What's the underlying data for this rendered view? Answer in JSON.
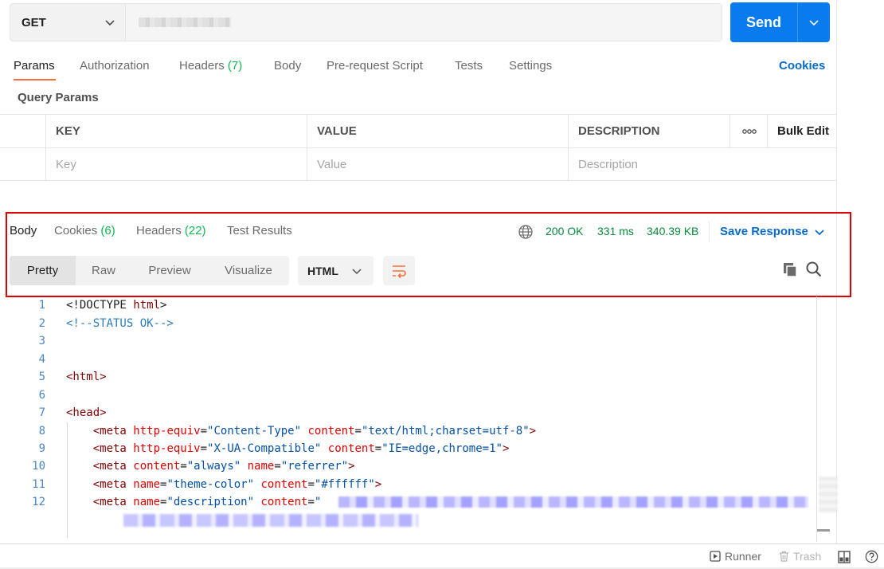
{
  "request": {
    "method": "GET",
    "send_label": "Send"
  },
  "request_tabs": [
    {
      "label": "Params",
      "count": ""
    },
    {
      "label": "Authorization",
      "count": ""
    },
    {
      "label": "Headers",
      "count": "(7)"
    },
    {
      "label": "Body",
      "count": ""
    },
    {
      "label": "Pre-request Script",
      "count": ""
    },
    {
      "label": "Tests",
      "count": ""
    },
    {
      "label": "Settings",
      "count": ""
    }
  ],
  "cookies_link": "Cookies",
  "query_params": {
    "title": "Query Params",
    "headers": [
      "KEY",
      "VALUE",
      "DESCRIPTION",
      "Bulk Edit"
    ],
    "placeholders": [
      "Key",
      "Value",
      "Description"
    ]
  },
  "response": {
    "tabs": [
      {
        "label": "Body",
        "count": ""
      },
      {
        "label": "Cookies",
        "count": "(6)"
      },
      {
        "label": "Headers",
        "count": "(22)"
      },
      {
        "label": "Test Results",
        "count": ""
      }
    ],
    "status": "200 OK",
    "time": "331 ms",
    "size": "340.39 KB",
    "save_label": "Save Response",
    "view_modes": [
      "Pretty",
      "Raw",
      "Preview",
      "Visualize"
    ],
    "format": "HTML"
  },
  "code_lines": [
    {
      "n": "1",
      "parts": [
        [
          "plain",
          "<!DOCTYPE "
        ],
        [
          "tag",
          "html"
        ],
        [
          "plain",
          ">"
        ]
      ]
    },
    {
      "n": "2",
      "parts": [
        [
          "cmt",
          "<!--STATUS OK-->"
        ]
      ]
    },
    {
      "n": "3",
      "parts": []
    },
    {
      "n": "4",
      "parts": []
    },
    {
      "n": "5",
      "parts": [
        [
          "tag",
          "<html>"
        ]
      ]
    },
    {
      "n": "6",
      "parts": []
    },
    {
      "n": "7",
      "parts": [
        [
          "tag",
          "<head>"
        ]
      ]
    },
    {
      "n": "8",
      "parts": [
        [
          "plain",
          "    "
        ],
        [
          "tag",
          "<meta "
        ],
        [
          "attr",
          "http-equiv"
        ],
        [
          "plain",
          "="
        ],
        [
          "val",
          "\"Content-Type\""
        ],
        [
          "plain",
          " "
        ],
        [
          "attr",
          "content"
        ],
        [
          "plain",
          "="
        ],
        [
          "val",
          "\"text/html;charset=utf-8\""
        ],
        [
          "tag",
          ">"
        ]
      ]
    },
    {
      "n": "9",
      "parts": [
        [
          "plain",
          "    "
        ],
        [
          "tag",
          "<meta "
        ],
        [
          "attr",
          "http-equiv"
        ],
        [
          "plain",
          "="
        ],
        [
          "val",
          "\"X-UA-Compatible\""
        ],
        [
          "plain",
          " "
        ],
        [
          "attr",
          "content"
        ],
        [
          "plain",
          "="
        ],
        [
          "val",
          "\"IE=edge,chrome=1\""
        ],
        [
          "tag",
          ">"
        ]
      ]
    },
    {
      "n": "10",
      "parts": [
        [
          "plain",
          "    "
        ],
        [
          "tag",
          "<meta "
        ],
        [
          "attr",
          "content"
        ],
        [
          "plain",
          "="
        ],
        [
          "val",
          "\"always\""
        ],
        [
          "plain",
          " "
        ],
        [
          "attr",
          "name"
        ],
        [
          "plain",
          "="
        ],
        [
          "val",
          "\"referrer\""
        ],
        [
          "tag",
          ">"
        ]
      ]
    },
    {
      "n": "11",
      "parts": [
        [
          "plain",
          "    "
        ],
        [
          "tag",
          "<meta "
        ],
        [
          "attr",
          "name"
        ],
        [
          "plain",
          "="
        ],
        [
          "val",
          "\"theme-color\""
        ],
        [
          "plain",
          " "
        ],
        [
          "attr",
          "content"
        ],
        [
          "plain",
          "="
        ],
        [
          "val",
          "\"#ffffff\""
        ],
        [
          "tag",
          ">"
        ]
      ]
    },
    {
      "n": "12",
      "parts": [
        [
          "plain",
          "    "
        ],
        [
          "tag",
          "<meta "
        ],
        [
          "attr",
          "name"
        ],
        [
          "plain",
          "="
        ],
        [
          "val",
          "\"description\""
        ],
        [
          "plain",
          " "
        ],
        [
          "attr",
          "content"
        ],
        [
          "plain",
          "="
        ],
        [
          "val",
          "\""
        ]
      ]
    }
  ],
  "statusbar": {
    "runner": "Runner",
    "trash": "Trash"
  },
  "colors": {
    "accent_orange": "#ff6c37",
    "send_blue": "#097bed",
    "link_blue": "#0b6bcb",
    "success_green": "#0a8a3c",
    "highlight_red": "#e00000"
  },
  "icons": [
    "chevron-down-icon",
    "globe-icon",
    "wrap-lines-icon",
    "copy-icon",
    "search-icon",
    "runner-icon",
    "trash-icon",
    "two-pane-icon",
    "help-icon",
    "more-icon"
  ]
}
